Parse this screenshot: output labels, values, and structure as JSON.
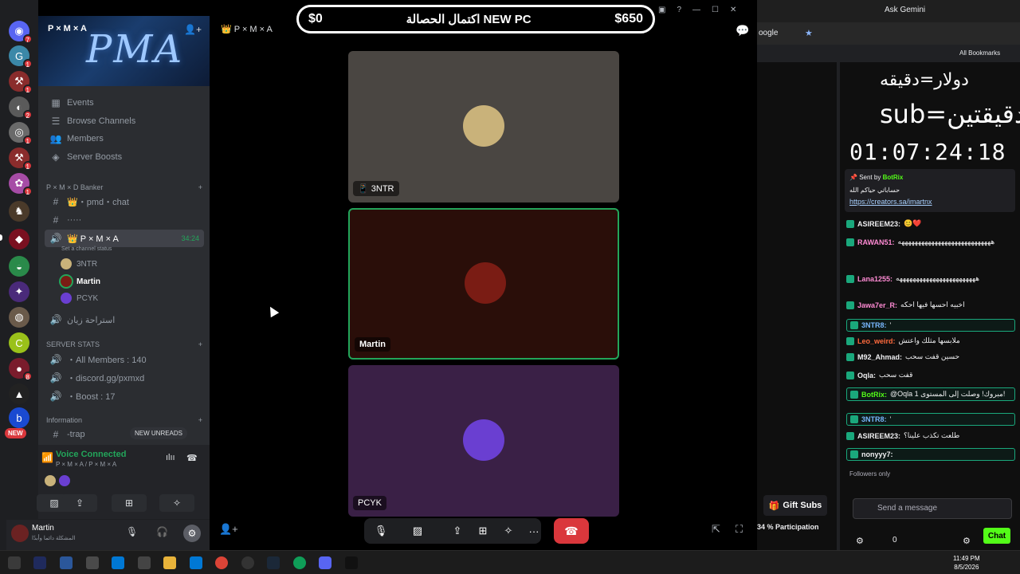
{
  "goal_bar": {
    "left": "$0",
    "middle": "اكتمال الحصالة NEW PC",
    "right": "$650"
  },
  "discord": {
    "server_name": "P × M × A",
    "banner_text": "PMA",
    "menu": [
      "Events",
      "Browse Channels",
      "Members",
      "Server Boosts"
    ],
    "categories": {
      "banker": "P × M × D Banker",
      "stats": "SERVER STATS",
      "info": "Information"
    },
    "channels": {
      "pmd_chat": "👑・pmd・chat",
      "dots": "·····",
      "voice_channel": "👑 P × M × A",
      "voice_time": "34:24",
      "status_hint": "Set a channel status",
      "rest_channel": "استراحة زيان",
      "all_members": "・All Members : 140",
      "invite": "・discord.gg/pxmxd",
      "boost": "・Boost : 17",
      "trap": "-trap"
    },
    "voice_members": [
      "3NTR",
      "Martin",
      "PCYK"
    ],
    "new_unreads": "NEW UNREADS",
    "new_tag": "NEW",
    "voice_connected": "Voice Connected",
    "voice_path": "P × M × A / P × M × A",
    "user_name": "Martin",
    "user_status": "المشكلة دائما وأبدًا",
    "call_header": "👑 P × M × A",
    "tiles": [
      {
        "label": "3NTR",
        "bg": "#4a4642",
        "avatar": "#c9b27a"
      },
      {
        "label": "Martin",
        "bg": "#2a0e09",
        "avatar": "#7a1c14"
      },
      {
        "label": "PCYK",
        "bg": "#3a2046",
        "avatar": "#6a3fd1"
      }
    ],
    "server_badges": [
      "7",
      "1",
      "1",
      "2",
      "1",
      "1",
      "1",
      "1",
      "8",
      "1"
    ]
  },
  "browser": {
    "ask_gemini": "Ask Gemini",
    "all_bookmarks": "All Bookmarks",
    "address_fragment": "oogle"
  },
  "stream": {
    "overlay_line1": "دولار=دقيقه",
    "overlay_line2": "sub=دقيقتين",
    "timer": "01:07:24:18",
    "pinned_by": "Sent by",
    "pinned_bot": "BotRix",
    "pinned_text": "حساباتي حياكم الله",
    "pinned_link": "https://creators.sa/imartnx",
    "messages": [
      {
        "user": "ASIREEM23:",
        "text": "😊❤️",
        "color": "#efeff1",
        "boxed": false
      },
      {
        "user": "RAWAN51:",
        "text": "ههههههههههههههههههههههههههههه",
        "color": "#ff8bd4",
        "boxed": false
      },
      {
        "user": "Lana1255:",
        "text": "ههههههههههههههههههههههههه",
        "color": "#ff8bd4",
        "boxed": false
      },
      {
        "user": "Jawa7er_R:",
        "text": "اخبيه احسها فيها احكه",
        "color": "#ff8bd4",
        "boxed": false
      },
      {
        "user": "3NTR8:",
        "text": "'",
        "color": "#79b8ff",
        "boxed": true
      },
      {
        "user": "Leo_weird:",
        "text": "ملابسها مثلك واعتش",
        "color": "#ff6a3d",
        "boxed": false
      },
      {
        "user": "M92_Ahmad:",
        "text": "حسين قفت سحب",
        "color": "#efeff1",
        "boxed": false
      },
      {
        "user": "Oqla:",
        "text": "قفت سحب",
        "color": "#efeff1",
        "boxed": false
      },
      {
        "user": "BotRix:",
        "text": "@Oqla مبروك! وصلت إلى المستوى 1!",
        "color": "#53fc18",
        "boxed": true
      },
      {
        "user": "3NTR8:",
        "text": "'",
        "color": "#79b8ff",
        "boxed": true
      },
      {
        "user": "ASIREEM23:",
        "text": "طلعت تكذب علينا؟",
        "color": "#efeff1",
        "boxed": false
      },
      {
        "user": "nonyyy7:",
        "text": "",
        "color": "#efeff1",
        "boxed": true
      }
    ],
    "followers_only": "Followers only",
    "gift_subs": "Gift Subs",
    "participation": "34 % Participation",
    "send_placeholder": "Send a message",
    "chat_button": "Chat",
    "count": "0"
  },
  "taskbar": {
    "time": "11:49 PM",
    "date": "8/5/2026"
  },
  "colors": {
    "discord_bg": "#2b2d31",
    "green": "#23a55a",
    "red": "#da373c",
    "kick_green": "#53fc18"
  }
}
